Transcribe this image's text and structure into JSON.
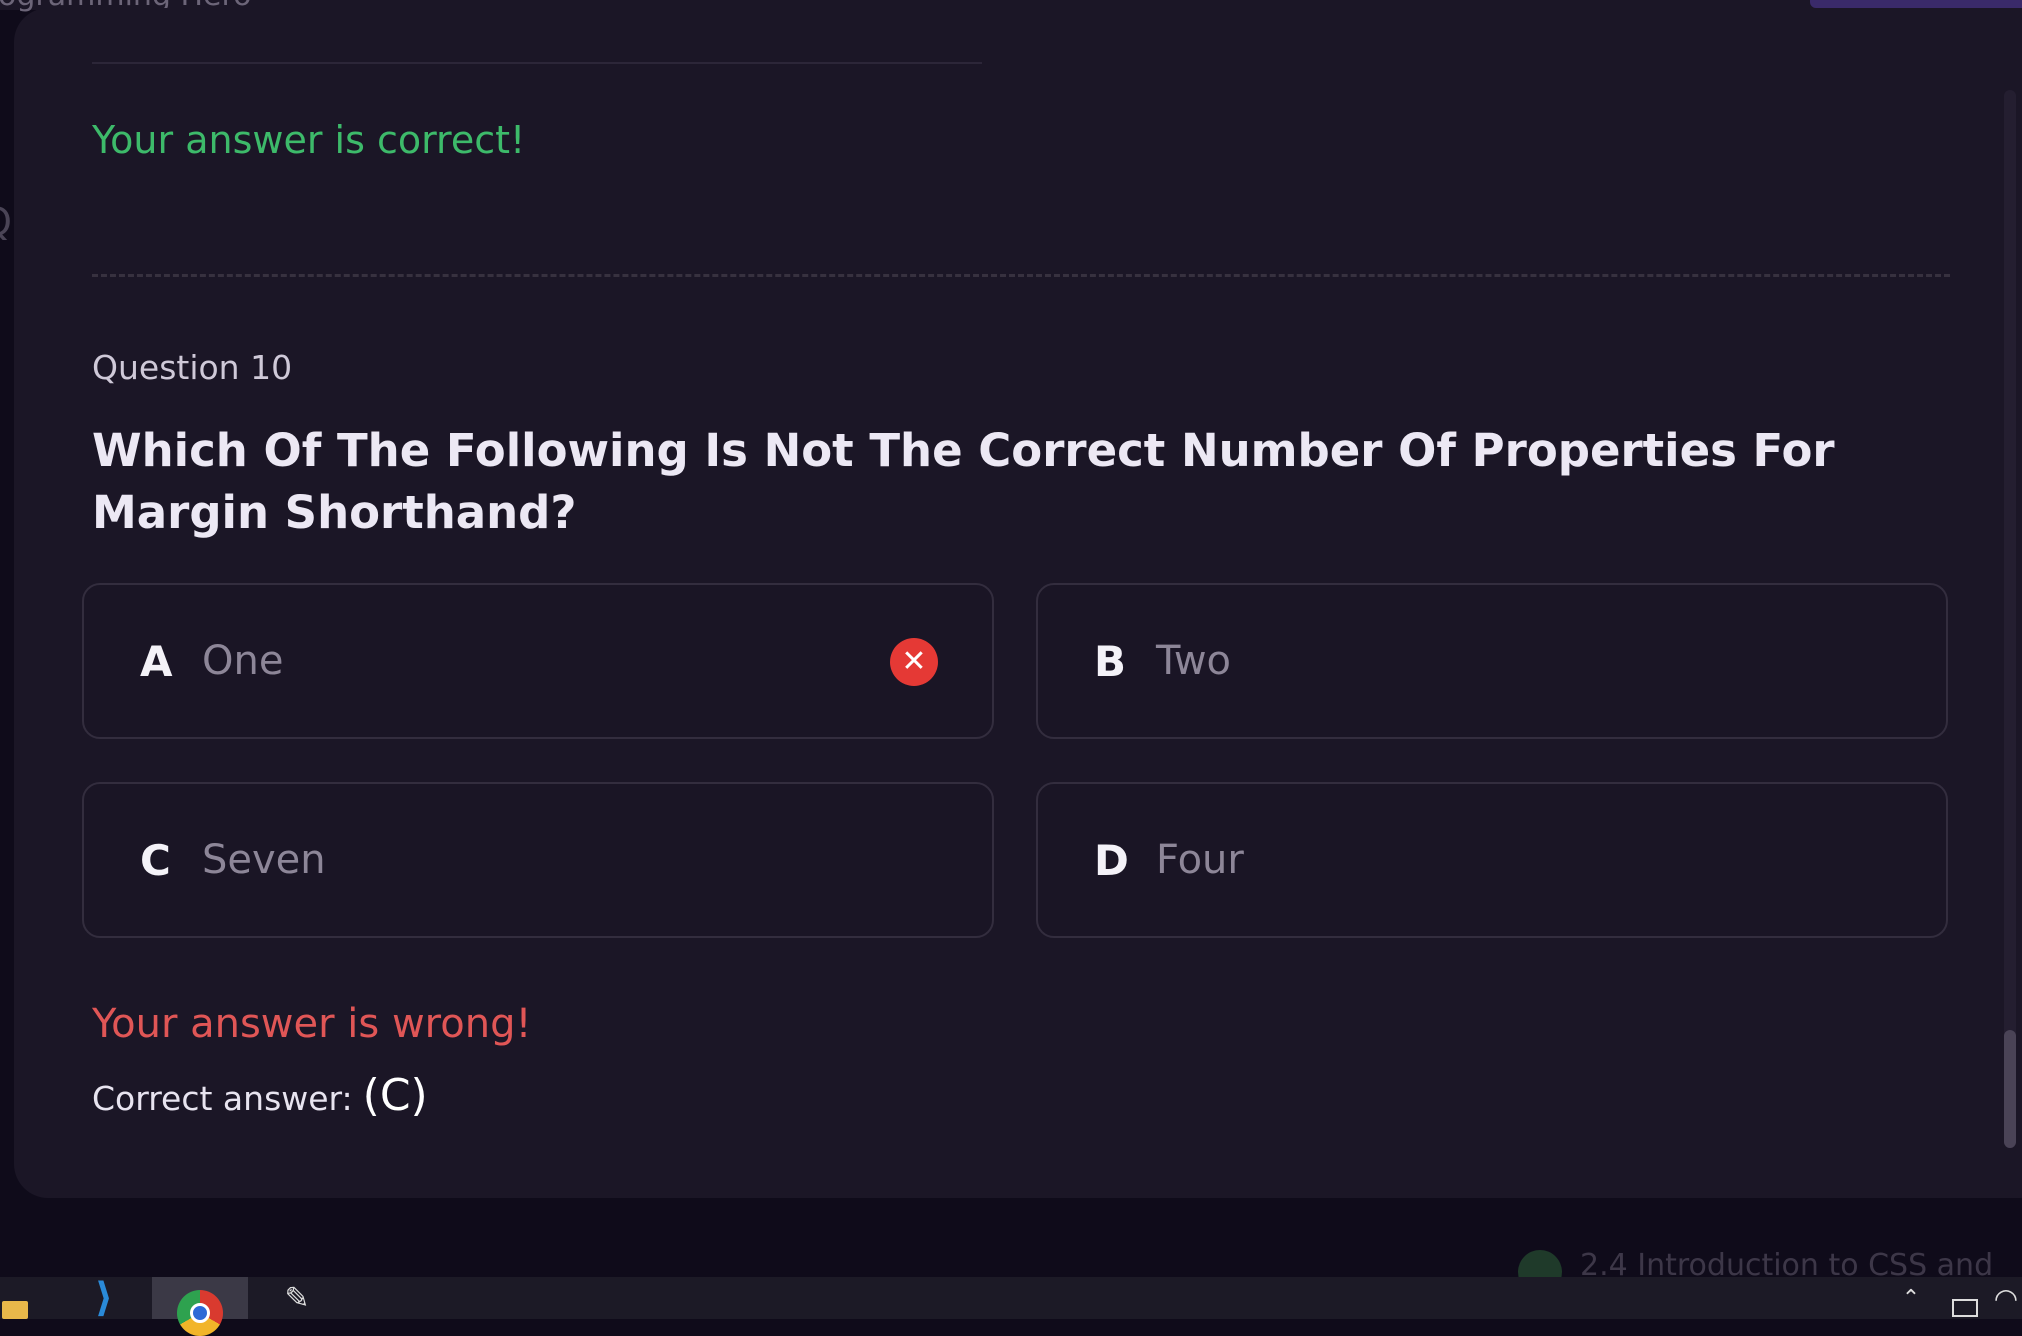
{
  "background": {
    "top_text": "ogramming Hero",
    "left_glyph": "Q",
    "bottom_text": "2.4 Introduction to CSS and"
  },
  "feedback_prev": {
    "message": "Your answer is correct!"
  },
  "question": {
    "number_label": "Question 10",
    "text": "Which Of The Following Is Not The Correct Number Of Properties For Margin Shorthand?",
    "options": [
      {
        "letter": "A",
        "text": "One",
        "state": "selected-wrong"
      },
      {
        "letter": "B",
        "text": "Two",
        "state": "default"
      },
      {
        "letter": "C",
        "text": "Seven",
        "state": "default"
      },
      {
        "letter": "D",
        "text": "Four",
        "state": "default"
      }
    ],
    "wrong_icon": "close-circle-icon"
  },
  "feedback": {
    "message": "Your answer is wrong!",
    "correct_label": "Correct answer:",
    "correct_value": "(C)"
  },
  "colors": {
    "correct": "#3dba6a",
    "wrong": "#e05656",
    "wrong_icon_bg": "#e53935",
    "modal_bg": "#1b1626"
  },
  "taskbar": {
    "icons": [
      "file-explorer-icon",
      "vscode-icon",
      "chrome-icon",
      "app-icon"
    ],
    "tray_icons": [
      "chevron-up-icon",
      "display-icon",
      "wifi-icon"
    ]
  }
}
